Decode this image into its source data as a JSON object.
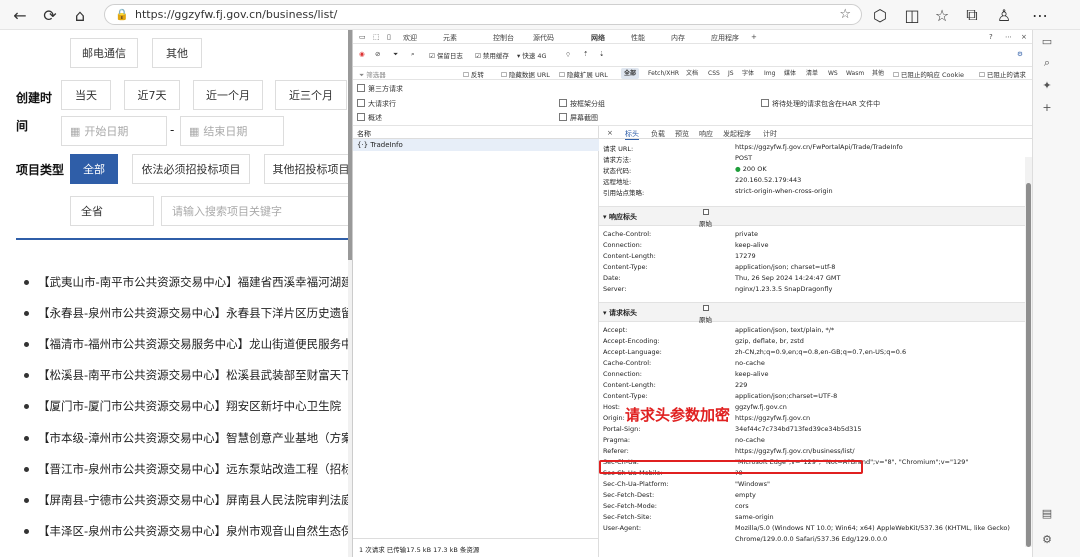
{
  "browser": {
    "url": "https://ggzyfw.fj.gov.cn/business/list/"
  },
  "site": {
    "category_buttons": [
      "邮电通信",
      "其他"
    ],
    "created_label_1": "创建时",
    "created_label_2": "间",
    "time_buttons": [
      "当天",
      "近7天",
      "近一个月",
      "近三个月"
    ],
    "start_placeholder": "开始日期",
    "dash": "-",
    "end_placeholder": "结束日期",
    "project_type_label": "项目类型",
    "type_buttons": [
      "全部",
      "依法必须招投标项目",
      "其他招投标项目"
    ],
    "province": "全省",
    "search_placeholder": "请输入搜索项目关键字",
    "items": [
      "【武夷山市-南平市公共资源交易中心】福建省西溪幸福河湖建设",
      "【永春县-泉州市公共资源交易中心】永春县下洋片区历史遗留矿",
      "【福清市-福州市公共资源交易服务中心】龙山街道便民服务中心",
      "【松溪县-南平市公共资源交易中心】松溪县武装部至财富天下楼",
      "【厦门市-厦门市公共资源交易中心】翔安区新圩中心卫生院（新",
      "【市本级-漳州市公共资源交易中心】智慧创意产业基地（方案设",
      "【晋江市-泉州市公共资源交易中心】远东泵站改造工程（招标公",
      "【屏南县-宁德市公共资源交易中心】屏南县人民法院审判法庭装",
      "【丰泽区-泉州市公共资源交易中心】泉州市观音山自然生态保护"
    ]
  },
  "devtools": {
    "tabs": [
      "欢迎",
      "元素",
      "控制台",
      "源代码",
      "网络",
      "性能",
      "内存",
      "应用程序",
      "+"
    ],
    "toolbar": {
      "preserve_log": "保留日志",
      "disable_cache": "禁用缓存",
      "throttle": "快速 4G"
    },
    "filter": {
      "placeholder": "筛选器",
      "invert": "反转",
      "hide_data_url": "隐藏数据 URL",
      "hide_ext_url": "隐藏扩展 URL",
      "types": [
        "全部",
        "Fetch/XHR",
        "文档",
        "CSS",
        "JS",
        "字体",
        "Img",
        "媒体",
        "清单",
        "WS",
        "Wasm",
        "其他"
      ],
      "blocked_cookie": "已阻止的响应 Cookie",
      "blocked_req": "已阻止的请求"
    },
    "options": {
      "third_party": "第三方请求",
      "big_rows": "大请求行",
      "group_by_frame": "按框架分组",
      "har_include": "将待处理的请求包含在HAR 文件中",
      "overview": "概述",
      "screenshots": "屏幕截图"
    },
    "list": {
      "name_header": "名称",
      "request_name": "TradeInfo",
      "footer": "1 次请求 已传输17.5 kB  17.3 kB 条资源"
    },
    "detail": {
      "tabs": [
        "×",
        "标头",
        "负载",
        "预览",
        "响应",
        "发起程序",
        "计时"
      ],
      "general": [
        {
          "k": "请求 URL:",
          "v": "https://ggzyfw.fj.gov.cn/FwPortalApi/Trade/TradeInfo"
        },
        {
          "k": "请求方法:",
          "v": "POST"
        },
        {
          "k": "状态代码:",
          "v": "200 OK"
        },
        {
          "k": "远程地址:",
          "v": "220.160.52.179:443"
        },
        {
          "k": "引用站点策略:",
          "v": "strict-origin-when-cross-origin"
        }
      ],
      "response_section": "▾ 响应标头",
      "raw_label": "原始",
      "response_headers": [
        {
          "k": "Cache-Control:",
          "v": "private"
        },
        {
          "k": "Connection:",
          "v": "keep-alive"
        },
        {
          "k": "Content-Length:",
          "v": "17279"
        },
        {
          "k": "Content-Type:",
          "v": "application/json; charset=utf-8"
        },
        {
          "k": "Date:",
          "v": "Thu, 26 Sep 2024 14:24:47 GMT"
        },
        {
          "k": "Server:",
          "v": "nginx/1.23.3.5 SnapDragonfly"
        }
      ],
      "request_section": "▾ 请求标头",
      "request_headers": [
        {
          "k": "Accept:",
          "v": "application/json, text/plain, */*"
        },
        {
          "k": "Accept-Encoding:",
          "v": "gzip, deflate, br, zstd"
        },
        {
          "k": "Accept-Language:",
          "v": "zh-CN,zh;q=0.9,en;q=0.8,en-GB;q=0.7,en-US;q=0.6"
        },
        {
          "k": "Cache-Control:",
          "v": "no-cache"
        },
        {
          "k": "Connection:",
          "v": "keep-alive"
        },
        {
          "k": "Content-Length:",
          "v": "229"
        },
        {
          "k": "Content-Type:",
          "v": "application/json;charset=UTF-8"
        },
        {
          "k": "Host:",
          "v": "ggzyfw.fj.gov.cn"
        },
        {
          "k": "Origin:",
          "v": "https://ggzyfw.fj.gov.cn"
        },
        {
          "k": "Portal-Sign:",
          "v": "34ef44c7c734bd713fed39ce34b5d315"
        },
        {
          "k": "Pragma:",
          "v": "no-cache"
        },
        {
          "k": "Referer:",
          "v": "https://ggzyfw.fj.gov.cn/business/list/"
        },
        {
          "k": "Sec-Ch-Ua:",
          "v": "\"Microsoft Edge\";v=\"129\", \"Not=A?Brand\";v=\"8\", \"Chromium\";v=\"129\""
        },
        {
          "k": "Sec-Ch-Ua-Mobile:",
          "v": "?0"
        },
        {
          "k": "Sec-Ch-Ua-Platform:",
          "v": "\"Windows\""
        },
        {
          "k": "Sec-Fetch-Dest:",
          "v": "empty"
        },
        {
          "k": "Sec-Fetch-Mode:",
          "v": "cors"
        },
        {
          "k": "Sec-Fetch-Site:",
          "v": "same-origin"
        },
        {
          "k": "User-Agent:",
          "v": "Mozilla/5.0 (Windows NT 10.0; Win64; x64) AppleWebKit/537.36 (KHTML, like Gecko)"
        },
        {
          "k": "",
          "v": "Chrome/129.0.0.0 Safari/537.36 Edg/129.0.0.0"
        }
      ]
    },
    "annotation": "请求头参数加密"
  },
  "colors": {
    "accent_blue": "#2f5ea8",
    "highlight_red": "#e02020",
    "status_green": "#1e9e3a"
  }
}
